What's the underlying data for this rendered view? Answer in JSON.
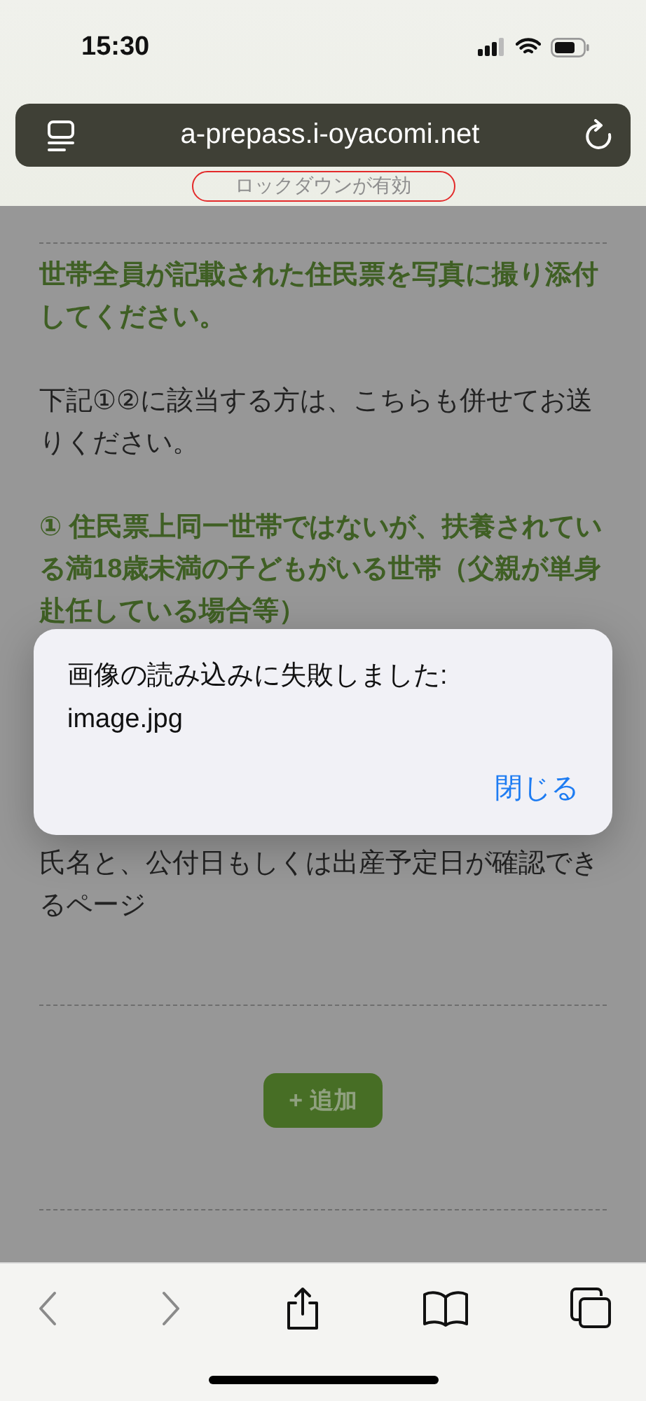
{
  "status_bar": {
    "time": "15:30"
  },
  "address_bar": {
    "url": "a-prepass.i-oyacomi.net"
  },
  "lockdown_label": "ロックダウンが有効",
  "page": {
    "blocks": [
      {
        "kind": "emphasis",
        "text": "世帯全員が記載された住民票を写真に撮り添付してください。"
      },
      {
        "kind": "plain",
        "text": "下記①②に該当する方は、こちらも併せてお送りください。"
      },
      {
        "kind": "emphasis",
        "text": "① 住民票上同一世帯ではないが、扶養されている満18歳未満の子どもがいる世帯（父親が単身赴任している場合等）"
      },
      {
        "kind": "plain",
        "text": "氏名と、公付日もしくは出産予定日が確認できるページ"
      }
    ],
    "add_button": "+ 追加"
  },
  "alert": {
    "message": "画像の読み込みに失敗しました:\nimage.jpg",
    "button": "閉じる"
  }
}
